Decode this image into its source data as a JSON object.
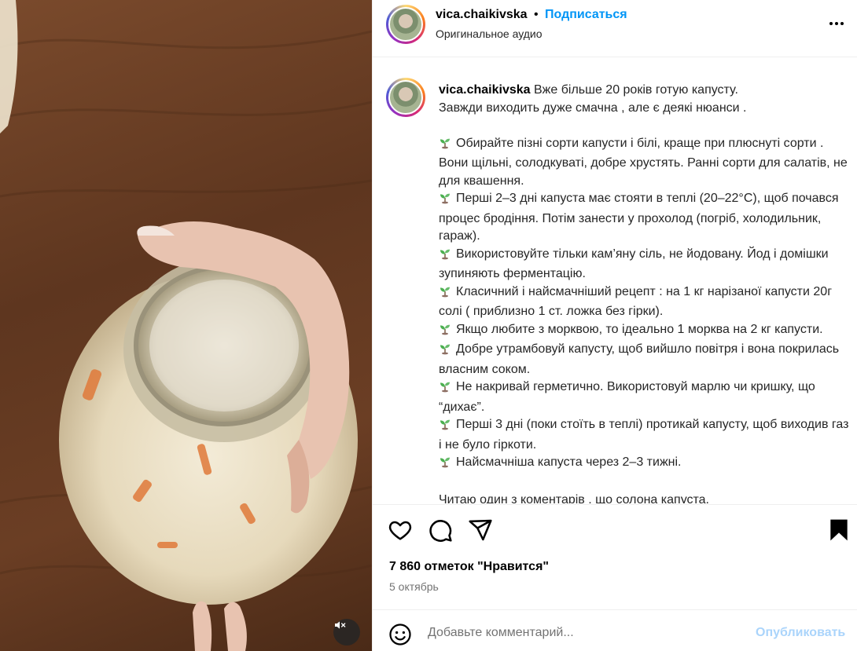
{
  "post": {
    "username": "vica.chaikivska",
    "separator": "•",
    "follow_label": "Подписаться",
    "audio": "Оригинальное аудио",
    "caption_intro_1": "Вже більше 20 років готую капусту.",
    "caption_intro_2": "Завжди виходить дуже смачна , але є деякі нюанси .",
    "tips": [
      "Обирайте пізні сорти капусти і білі, краще при плюснуті сорти . Вони щільні, солодкуваті, добре хрустять. Ранні сорти для салатів, не для квашення.",
      "Перші 2–3 дні капуста має стояти в теплі (20–22°C), щоб почався процес бродіння. Потім занести у прохолод (погріб, холодильник, гараж).",
      "Використовуйте тільки кам’яну сіль, не йодовану. Йод і домішки зупиняють ферментацію.",
      "Класичний і найсмачніший рецепт : на 1 кг нарізаної капусти 20г солі ( приблизно 1 ст. ложка без гірки).",
      "Якщо любите з морквою, то ідеально 1 морква на 2 кг капусти.",
      "Добре утрамбовуй капусту, щоб вийшло повітря і вона покрилась власним соком.",
      "Не накривай герметично. Використовуй марлю чи кришку, що “дихає”.",
      "Перші 3 дні (поки стоїть в теплі) протикай капусту, щоб виходив газ і не було гіркоти.",
      "Найсмачніша капуста через 2–3 тижні."
    ],
    "caption_outro": "Читаю один з коментарів , що солона капуста.",
    "likes": "7 860 отметок \"Нравится\"",
    "date": "5 октябрь"
  },
  "comment": {
    "placeholder": "Добавьте комментарий...",
    "publish_label": "Опубликовать"
  },
  "icons": {
    "tip_bullet": "seedling-icon",
    "actions": [
      "heart-icon",
      "comment-icon",
      "share-icon",
      "bookmark-icon"
    ],
    "mute": "speaker-muted-icon",
    "emoji": "smiley-icon",
    "more": "more-horizontal-icon"
  },
  "colors": {
    "link": "#0095f6",
    "publish_disabled": "#aad4fb",
    "muted_text": "#737373",
    "divider": "#efefef"
  }
}
